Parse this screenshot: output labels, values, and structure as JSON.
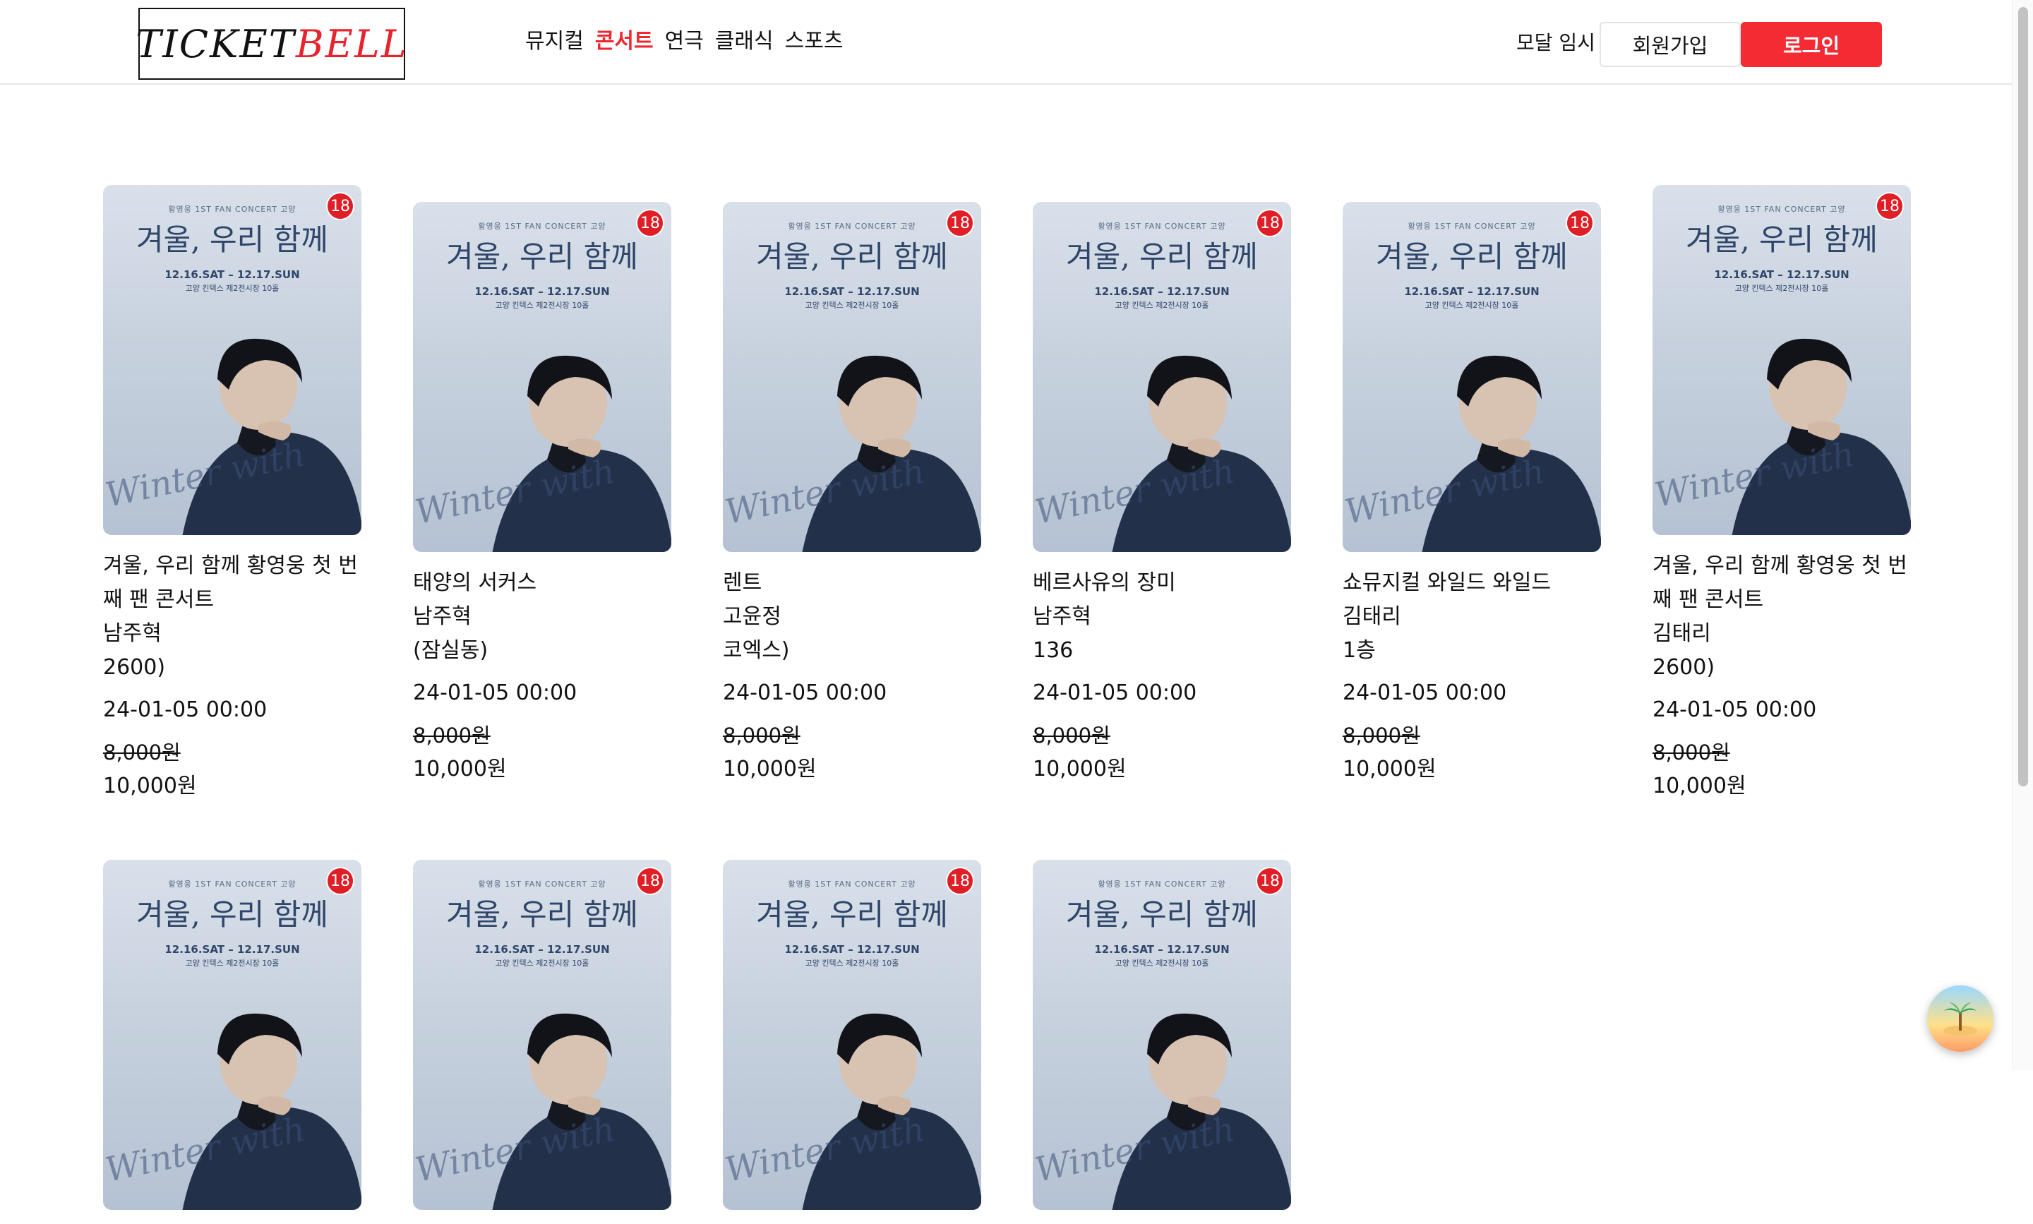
{
  "header": {
    "logo_ticket": "TICKET",
    "logo_bell": "BELL",
    "nav": [
      {
        "label": "뮤지컬",
        "active": false
      },
      {
        "label": "콘서트",
        "active": true
      },
      {
        "label": "연극",
        "active": false
      },
      {
        "label": "클래식",
        "active": false
      },
      {
        "label": "스포츠",
        "active": false
      }
    ],
    "modal_label": "모달 임시",
    "signup_label": "회원가입",
    "login_label": "로그인"
  },
  "poster": {
    "subtitle": "황영웅 1ST FAN CONCERT 고양",
    "title": "겨울, 우리 함께",
    "dates": "12.16.SAT – 12.17.SUN",
    "venue": "고양 킨텍스 제2전시장 10홀",
    "script": "Winter with",
    "age": "18"
  },
  "cards": [
    {
      "lines": [
        "겨울, 우리 함께 황영웅 첫 번",
        "째 팬 콘서트",
        "남주혁",
        "2600)"
      ],
      "date": "24-01-05 00:00",
      "old_price": "8,000원",
      "price": "10,000원"
    },
    {
      "lines": [
        "태양의 서커스",
        "남주혁",
        "(잠실동)"
      ],
      "date": "24-01-05 00:00",
      "old_price": "8,000원",
      "price": "10,000원"
    },
    {
      "lines": [
        "렌트",
        "고윤정",
        "코엑스)"
      ],
      "date": "24-01-05 00:00",
      "old_price": "8,000원",
      "price": "10,000원"
    },
    {
      "lines": [
        "베르사유의 장미",
        "남주혁",
        "136"
      ],
      "date": "24-01-05 00:00",
      "old_price": "8,000원",
      "price": "10,000원"
    },
    {
      "lines": [
        "쇼뮤지컬 와일드 와일드",
        "김태리",
        "1층"
      ],
      "date": "24-01-05 00:00",
      "old_price": "8,000원",
      "price": "10,000원"
    },
    {
      "lines": [
        "겨울, 우리 함께 황영웅 첫 번",
        "째 팬 콘서트",
        "김태리",
        "2600)"
      ],
      "date": "24-01-05 00:00",
      "old_price": "8,000원",
      "price": "10,000원"
    },
    {
      "lines": [],
      "date": "",
      "old_price": "",
      "price": ""
    },
    {
      "lines": [],
      "date": "",
      "old_price": "",
      "price": ""
    },
    {
      "lines": [],
      "date": "",
      "old_price": "",
      "price": ""
    },
    {
      "lines": [],
      "date": "",
      "old_price": "",
      "price": ""
    }
  ],
  "colors": {
    "accent": "#f42b33",
    "badge": "#e01e26"
  },
  "icons": {
    "floating": "beach-island-icon"
  }
}
